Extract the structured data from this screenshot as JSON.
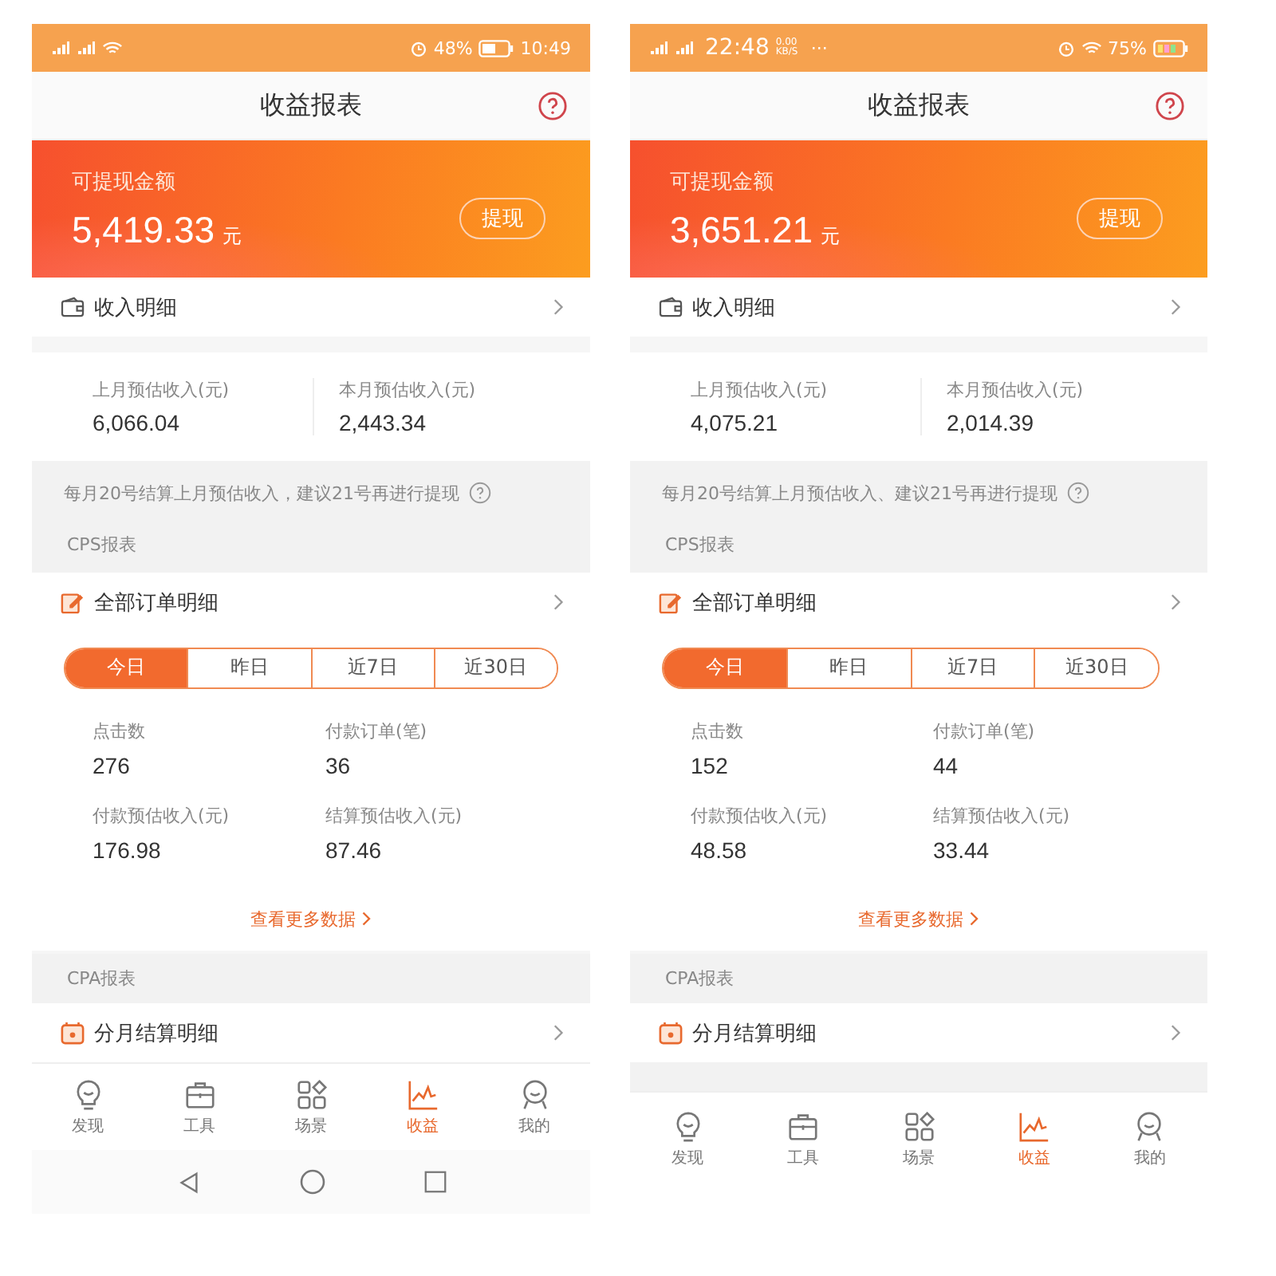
{
  "phones": [
    {
      "status_bar": {
        "kind": "time_right",
        "texts": [
          "48%",
          "10:49"
        ]
      },
      "title": "收益报表",
      "balance": {
        "label": "可提现金额",
        "amount": "5,419.33",
        "unit": "元",
        "button": "提现"
      },
      "income_row": "收入明细",
      "stats": [
        {
          "label": "上月预估收入(元)",
          "value": "6,066.04"
        },
        {
          "label": "本月预估收入(元)",
          "value": "2,443.34"
        }
      ],
      "notice": "每月20号结算上月预估收入，建议21号再进行提现",
      "cps": {
        "label": "CPS报表",
        "row": "全部订单明细",
        "tabs": [
          {
            "label": "今日",
            "selected": true
          },
          {
            "label": "昨日",
            "selected": false
          },
          {
            "label": "近7日",
            "selected": false
          },
          {
            "label": "近30日",
            "selected": false
          }
        ],
        "metrics": [
          {
            "label": "点击数",
            "value": "276"
          },
          {
            "label": "付款订单(笔)",
            "value": "36"
          },
          {
            "label": "付款预估收入(元)",
            "value": "176.98"
          },
          {
            "label": "结算预估收入(元)",
            "value": "87.46"
          }
        ],
        "more": "查看更多数据"
      },
      "cpa": {
        "label": "CPA报表",
        "row": "分月结算明细"
      },
      "bottom_tabs": [
        {
          "label": "发现",
          "selected": false
        },
        {
          "label": "工具",
          "selected": false
        },
        {
          "label": "场景",
          "selected": false
        },
        {
          "label": "收益",
          "selected": true
        },
        {
          "label": "我的",
          "selected": false
        }
      ],
      "nav_bar": true
    },
    {
      "status_bar": {
        "kind": "time_left",
        "texts": [
          "22:48",
          "0.00 KB/S",
          "···",
          "75%"
        ]
      },
      "title": "收益报表",
      "balance": {
        "label": "可提现金额",
        "amount": "3,651.21",
        "unit": "元",
        "button": "提现"
      },
      "income_row": "收入明细",
      "stats": [
        {
          "label": "上月预估收入(元)",
          "value": "4,075.21"
        },
        {
          "label": "本月预估收入(元)",
          "value": "2,014.39"
        }
      ],
      "notice": "每月20号结算上月预估收入、建议21号再进行提现",
      "cps": {
        "label": "CPS报表",
        "row": "全部订单明细",
        "tabs": [
          {
            "label": "今日",
            "selected": true
          },
          {
            "label": "昨日",
            "selected": false
          },
          {
            "label": "近7日",
            "selected": false
          },
          {
            "label": "近30日",
            "selected": false
          }
        ],
        "metrics": [
          {
            "label": "点击数",
            "value": "152"
          },
          {
            "label": "付款订单(笔)",
            "value": "44"
          },
          {
            "label": "付款预估收入(元)",
            "value": "48.58"
          },
          {
            "label": "结算预估收入(元)",
            "value": "33.44"
          }
        ],
        "more": "查看更多数据"
      },
      "cpa": {
        "label": "CPA报表",
        "row": "分月结算明细"
      },
      "bottom_tabs": [
        {
          "label": "发现",
          "selected": false
        },
        {
          "label": "工具",
          "selected": false
        },
        {
          "label": "场景",
          "selected": false
        },
        {
          "label": "收益",
          "selected": true
        },
        {
          "label": "我的",
          "selected": false
        }
      ],
      "nav_bar": false
    }
  ]
}
